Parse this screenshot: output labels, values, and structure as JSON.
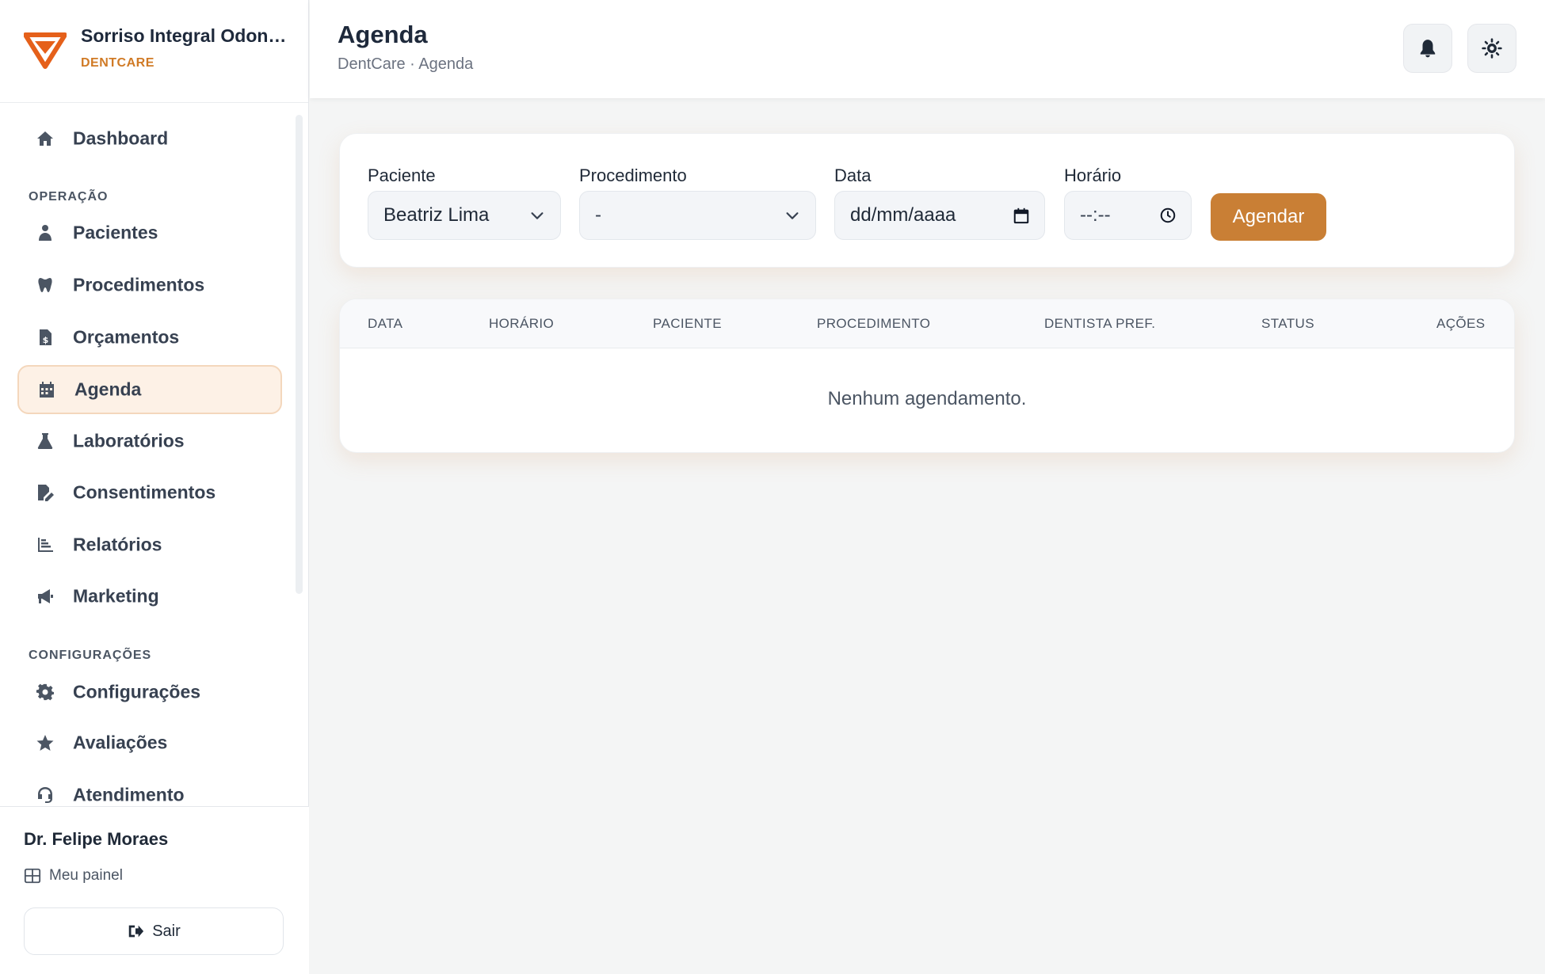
{
  "brand": {
    "name": "Sorriso Integral Odonto...",
    "subtitle": "DENTCARE"
  },
  "nav": {
    "dashboard": "Dashboard",
    "section_operacao": "OPERAÇÃO",
    "pacientes": "Pacientes",
    "procedimentos": "Procedimentos",
    "orcamentos": "Orçamentos",
    "agenda": "Agenda",
    "laboratorios": "Laboratórios",
    "consentimentos": "Consentimentos",
    "relatorios": "Relatórios",
    "marketing": "Marketing",
    "section_configuracoes": "CONFIGURAÇÕES",
    "configuracoes": "Configurações",
    "avaliacoes": "Avaliações",
    "atendimento": "Atendimento"
  },
  "user": {
    "name": "Dr. Felipe Moraes",
    "panel_label": "Meu painel",
    "logout_label": "Sair"
  },
  "header": {
    "title": "Agenda",
    "breadcrumb": "DentCare · Agenda"
  },
  "form": {
    "paciente_label": "Paciente",
    "paciente_value": "Beatriz Lima",
    "procedimento_label": "Procedimento",
    "procedimento_value": "-",
    "data_label": "Data",
    "data_placeholder": "dd/mm/aaaa",
    "horario_label": "Horário",
    "horario_placeholder": "--:--",
    "submit_label": "Agendar"
  },
  "table": {
    "columns": [
      "DATA",
      "HORÁRIO",
      "PACIENTE",
      "PROCEDIMENTO",
      "DENTISTA PREF.",
      "STATUS",
      "AÇÕES"
    ],
    "empty_message": "Nenhum agendamento."
  },
  "colors": {
    "accent": "#c97f35",
    "brand_orange": "#e5601a",
    "active_bg": "#fdf1e6"
  }
}
